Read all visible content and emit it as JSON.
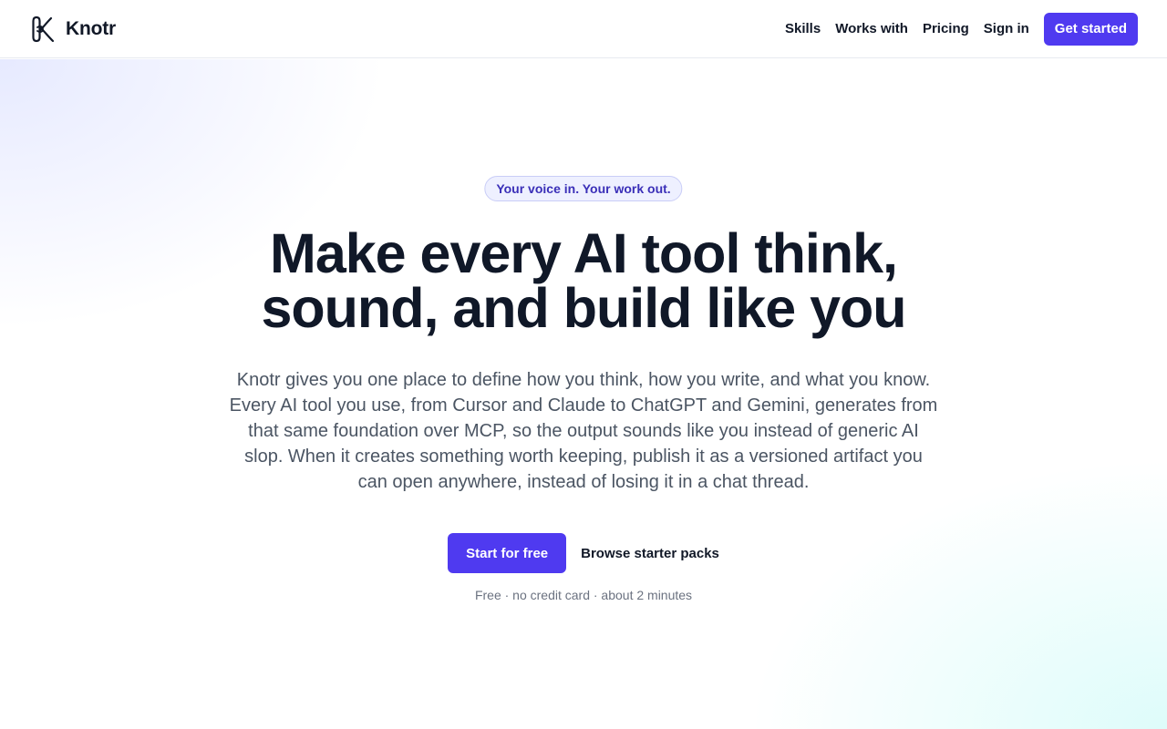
{
  "brand": {
    "name": "Knotr",
    "logo_icon": "knot-k-logo-icon"
  },
  "nav": {
    "links": [
      "Skills",
      "Works with",
      "Pricing",
      "Sign in"
    ],
    "cta_label": "Get started"
  },
  "hero": {
    "tagline": "Your voice in. Your work out.",
    "headline_lines": [
      "Make every AI tool think,",
      "sound, and build like you"
    ],
    "lede": "Knotr gives you one place to define how you think, how you write, and what you know. Every AI tool you use, from Cursor and Claude to ChatGPT and Gemini, generates from that same foundation over MCP, so the output sounds like you instead of generic AI slop. When it creates something worth keeping, publish it as a versioned artifact you can open anywhere, instead of losing it in a chat thread.",
    "primary_cta": "Start for free",
    "secondary_cta": "Browse starter packs",
    "fineprint": "Free · no credit card · about 2 minutes"
  },
  "colors": {
    "accent": "#4f3af0",
    "heading": "#101828",
    "body_text": "#4b5563",
    "tag_text": "#3a2fb8"
  }
}
